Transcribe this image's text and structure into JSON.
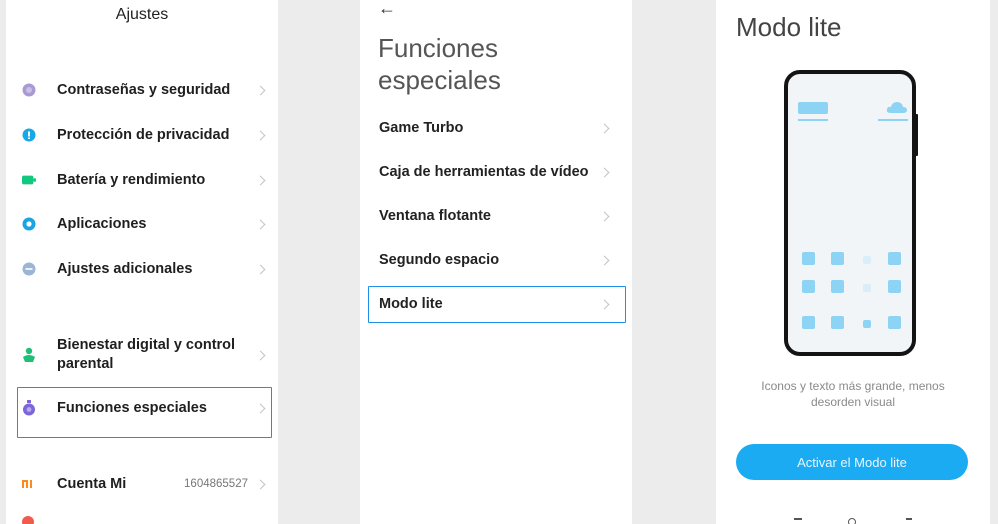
{
  "settings": {
    "title": "Ajustes",
    "items": [
      {
        "label": "Contraseñas y seguridad",
        "icon": "lock-icon",
        "color": "#a99ad4"
      },
      {
        "label": "Protección de privacidad",
        "icon": "privacy-icon",
        "color": "#17a8e8"
      },
      {
        "label": "Batería y rendimiento",
        "icon": "battery-icon",
        "color": "#12c780"
      },
      {
        "label": "Aplicaciones",
        "icon": "apps-gear-icon",
        "color": "#1aa4e6"
      },
      {
        "label": "Ajustes adicionales",
        "icon": "more-icon",
        "color": "#9cb4d6"
      },
      {
        "label": "Bienestar digital y control parental",
        "icon": "wellbeing-icon",
        "color": "#1fbf78"
      },
      {
        "label": "Funciones especiales",
        "icon": "special-features-icon",
        "color": "#7b67d8"
      },
      {
        "label": "Cuenta Mi",
        "icon": "mi-icon",
        "value": "1604865527",
        "color": "#ff8a1a"
      }
    ]
  },
  "special": {
    "back": "←",
    "title": "Funciones especiales",
    "items": [
      {
        "label": "Game Turbo"
      },
      {
        "label": "Caja de herramientas de vídeo"
      },
      {
        "label": "Ventana flotante"
      },
      {
        "label": "Segundo espacio"
      },
      {
        "label": "Modo lite"
      }
    ]
  },
  "lite": {
    "title": "Modo lite",
    "description": "Iconos y texto más grande, menos desorden visual",
    "button": "Activar el Modo lite",
    "accent": "#1aabf2"
  }
}
